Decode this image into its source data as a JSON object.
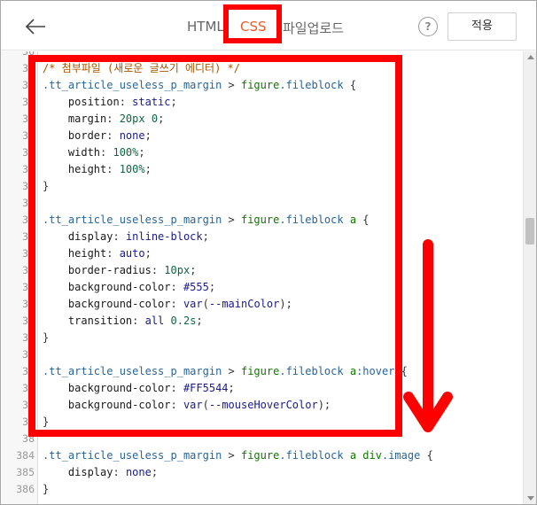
{
  "header": {
    "back_icon": "arrow-left-icon",
    "tabs": [
      {
        "label": "HTML",
        "active": false
      },
      {
        "label": "CSS",
        "active": true
      },
      {
        "label": "파일업로드",
        "active": false
      }
    ],
    "help_label": "?",
    "apply_label": "적용",
    "accent_color": "#f05a28"
  },
  "editor": {
    "lines": [
      {
        "n": "36",
        "partial": true,
        "tokens": []
      },
      {
        "n": "36",
        "tokens": [
          [
            "t-comment",
            "/* 첨부파일 (새로운 글쓰기 에디터) */"
          ]
        ]
      },
      {
        "n": "36",
        "tokens": [
          [
            "t-sel",
            ".tt_article_useless_p_margin"
          ],
          [
            "t-punc",
            " > "
          ],
          [
            "t-tag",
            "figure"
          ],
          [
            "t-sel",
            ".fileblock"
          ],
          [
            "t-punc",
            " {"
          ]
        ]
      },
      {
        "n": "36",
        "tokens": [
          [
            "t-prop",
            "    position"
          ],
          [
            "t-punc",
            ": "
          ],
          [
            "t-val",
            "static"
          ],
          [
            "t-punc",
            ";"
          ]
        ]
      },
      {
        "n": "36",
        "tokens": [
          [
            "t-prop",
            "    margin"
          ],
          [
            "t-punc",
            ": "
          ],
          [
            "t-num",
            "20px 0"
          ],
          [
            "t-punc",
            ";"
          ]
        ]
      },
      {
        "n": "36",
        "tokens": [
          [
            "t-prop",
            "    border"
          ],
          [
            "t-punc",
            ": "
          ],
          [
            "t-val",
            "none"
          ],
          [
            "t-punc",
            ";"
          ]
        ]
      },
      {
        "n": "36",
        "tokens": [
          [
            "t-prop",
            "    width"
          ],
          [
            "t-punc",
            ": "
          ],
          [
            "t-num",
            "100%"
          ],
          [
            "t-punc",
            ";"
          ]
        ]
      },
      {
        "n": "36",
        "tokens": [
          [
            "t-prop",
            "    height"
          ],
          [
            "t-punc",
            ": "
          ],
          [
            "t-num",
            "100%"
          ],
          [
            "t-punc",
            ";"
          ]
        ]
      },
      {
        "n": "36",
        "tokens": [
          [
            "t-punc",
            "}"
          ]
        ]
      },
      {
        "n": "37",
        "tokens": []
      },
      {
        "n": "37",
        "tokens": [
          [
            "t-sel",
            ".tt_article_useless_p_margin"
          ],
          [
            "t-punc",
            " > "
          ],
          [
            "t-tag",
            "figure"
          ],
          [
            "t-sel",
            ".fileblock"
          ],
          [
            "t-punc",
            " "
          ],
          [
            "t-tag",
            "a"
          ],
          [
            "t-punc",
            " {"
          ]
        ]
      },
      {
        "n": "37",
        "tokens": [
          [
            "t-prop",
            "    display"
          ],
          [
            "t-punc",
            ": "
          ],
          [
            "t-val",
            "inline-block"
          ],
          [
            "t-punc",
            ";"
          ]
        ]
      },
      {
        "n": "37",
        "tokens": [
          [
            "t-prop",
            "    height"
          ],
          [
            "t-punc",
            ": "
          ],
          [
            "t-val",
            "auto"
          ],
          [
            "t-punc",
            ";"
          ]
        ]
      },
      {
        "n": "37",
        "tokens": [
          [
            "t-prop",
            "    border-radius"
          ],
          [
            "t-punc",
            ": "
          ],
          [
            "t-num",
            "10px"
          ],
          [
            "t-punc",
            ";"
          ]
        ]
      },
      {
        "n": "37",
        "tokens": [
          [
            "t-prop",
            "    background-color"
          ],
          [
            "t-punc",
            ": "
          ],
          [
            "t-val",
            "#555"
          ],
          [
            "t-punc",
            ";"
          ]
        ]
      },
      {
        "n": "37",
        "tokens": [
          [
            "t-prop",
            "    background-color"
          ],
          [
            "t-punc",
            ": "
          ],
          [
            "t-val",
            "var"
          ],
          [
            "t-punc",
            "("
          ],
          [
            "t-val",
            "--mainColor"
          ],
          [
            "t-punc",
            ");"
          ]
        ]
      },
      {
        "n": "37",
        "tokens": [
          [
            "t-prop",
            "    transition"
          ],
          [
            "t-punc",
            ": "
          ],
          [
            "t-val",
            "all "
          ],
          [
            "t-num",
            "0.2s"
          ],
          [
            "t-punc",
            ";"
          ]
        ]
      },
      {
        "n": "37",
        "tokens": [
          [
            "t-punc",
            "}"
          ]
        ]
      },
      {
        "n": "37",
        "tokens": []
      },
      {
        "n": "37",
        "tokens": [
          [
            "t-sel",
            ".tt_article_useless_p_margin"
          ],
          [
            "t-punc",
            " > "
          ],
          [
            "t-tag",
            "figure"
          ],
          [
            "t-sel",
            ".fileblock"
          ],
          [
            "t-punc",
            " "
          ],
          [
            "t-tag",
            "a"
          ],
          [
            "t-sel",
            ":hover"
          ],
          [
            "t-punc",
            " {"
          ]
        ]
      },
      {
        "n": "38",
        "tokens": [
          [
            "t-prop",
            "    background-color"
          ],
          [
            "t-punc",
            ": "
          ],
          [
            "t-val",
            "#FF5544"
          ],
          [
            "t-punc",
            ";"
          ]
        ]
      },
      {
        "n": "38",
        "tokens": [
          [
            "t-prop",
            "    background-color"
          ],
          [
            "t-punc",
            ": "
          ],
          [
            "t-val",
            "var"
          ],
          [
            "t-punc",
            "("
          ],
          [
            "t-val",
            "--mouseHoverColor"
          ],
          [
            "t-punc",
            ");"
          ]
        ]
      },
      {
        "n": "38",
        "tokens": [
          [
            "t-punc",
            "}"
          ]
        ]
      },
      {
        "n": "38",
        "tokens": []
      },
      {
        "n": "384",
        "tokens": [
          [
            "t-sel",
            ".tt_article_useless_p_margin"
          ],
          [
            "t-punc",
            " > "
          ],
          [
            "t-tag",
            "figure"
          ],
          [
            "t-sel",
            ".fileblock"
          ],
          [
            "t-punc",
            " "
          ],
          [
            "t-tag",
            "a"
          ],
          [
            "t-punc",
            " "
          ],
          [
            "t-tag",
            "div"
          ],
          [
            "t-sel",
            ".image"
          ],
          [
            "t-punc",
            " {"
          ]
        ]
      },
      {
        "n": "385",
        "tokens": [
          [
            "t-prop",
            "    display"
          ],
          [
            "t-punc",
            ": "
          ],
          [
            "t-val",
            "none"
          ],
          [
            "t-punc",
            ";"
          ]
        ]
      },
      {
        "n": "386",
        "tokens": [
          [
            "t-punc",
            "}"
          ]
        ]
      }
    ]
  },
  "annotations": {
    "highlight_color": "#ff0000"
  }
}
